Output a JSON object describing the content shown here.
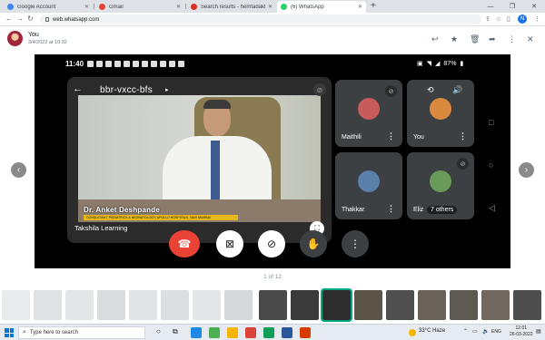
{
  "browser": {
    "tabs": [
      {
        "title": "Google Account",
        "favicon_color": "#4285f4",
        "active": false
      },
      {
        "title": "Gmail",
        "favicon_color": "#ea4335",
        "active": false
      },
      {
        "title": "Search results - hemtadaklani@...",
        "favicon_color": "#d93025",
        "active": false
      },
      {
        "title": "(6) WhatsApp",
        "favicon_color": "#25d366",
        "active": true
      }
    ],
    "new_tab_label": "+",
    "url": "web.whatsapp.com",
    "profile_initial": "N"
  },
  "viewer": {
    "sender": "You",
    "sent_time": "3/4/2022 at 10:32",
    "page_counter": "1 of 12"
  },
  "phone": {
    "time": "11:40",
    "battery": "87%"
  },
  "meet": {
    "name": "bbr-vxcc-bfs",
    "main_speaker_label": "Takshila Learning",
    "video_doctor_name": "Dr. Anket Deshpande",
    "video_doctor_title": "CONSULTANT, PEDIATRICS & NEONATOLOGY, APOLLO HOSPITALS, NAVI MUMBAI",
    "participants": [
      {
        "name": "Maithili",
        "avatar_color": "#c75b5b"
      },
      {
        "name": "You",
        "avatar_color": "#d98a3e"
      },
      {
        "name": "Thakkar",
        "avatar_color": "#5a7fa8"
      },
      {
        "name": "Eliz",
        "avatar_color": "#6a9a5a"
      }
    ],
    "others_badge": "7 others"
  },
  "taskbar": {
    "search_placeholder": "Type here to search",
    "weather": "33°C  Haze",
    "language": "ENG",
    "time": "12:01",
    "date": "26-03-2022"
  }
}
